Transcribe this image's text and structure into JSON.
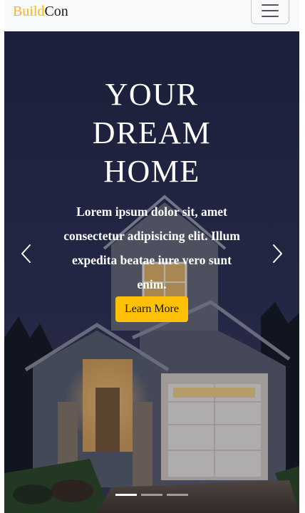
{
  "navbar": {
    "brand_primary": "Build",
    "brand_secondary": "Con",
    "brand_color": "#ffb30f",
    "toggler_icon": "hamburger-menu-icon"
  },
  "hero": {
    "headline_line1": "YOUR",
    "headline_line2": "DREAM",
    "headline_line3": "HOME",
    "lead": "Lorem ipsum dolor sit, amet consectetur adipisicing elit. Illum expedita beatae iure vero sunt enim.",
    "button_label": "Learn More",
    "button_color": "#ffc107",
    "prev_icon": "chevron-left-icon",
    "next_icon": "chevron-right-icon",
    "slide_count": 3,
    "active_slide": 1
  }
}
